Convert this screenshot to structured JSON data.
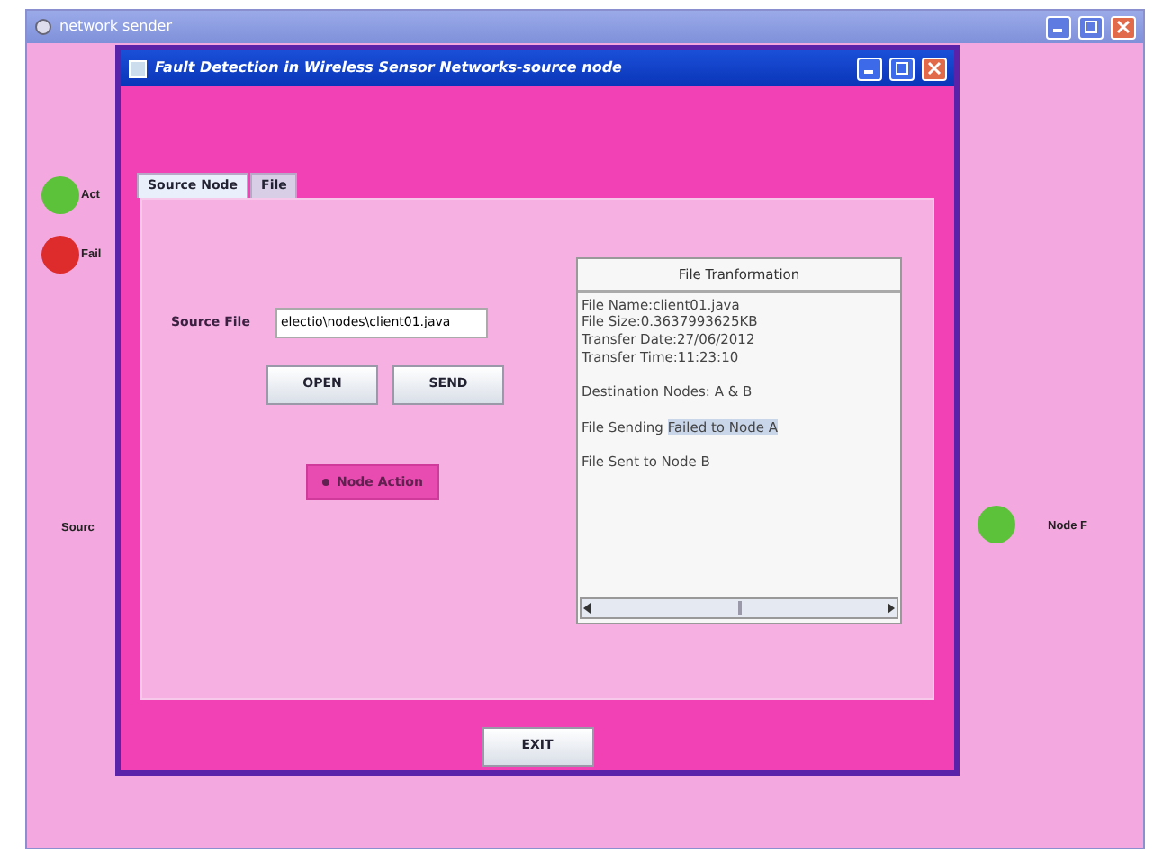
{
  "outer_window": {
    "title": "network sender"
  },
  "legend": [
    {
      "label": "Act",
      "color": "#5cc23a"
    },
    {
      "label": "Fail",
      "color": "#de2b2b"
    }
  ],
  "source_label": "Sourc",
  "node": {
    "label": "Node F",
    "color": "#5cc23a"
  },
  "inner_window": {
    "title": "Fault Detection in Wireless Sensor Networks-source node",
    "tabs": [
      {
        "label": "Source Node",
        "selected": true
      },
      {
        "label": "File",
        "selected": false
      }
    ],
    "source_file": {
      "label": "Source File",
      "value": "electio\\nodes\\client01.java"
    },
    "buttons": [
      "OPEN",
      "SEND"
    ],
    "action_button": "Node Action",
    "log": {
      "header": "File Tranformation",
      "groups": [
        [
          {
            "text": "File Name:client01.java"
          },
          {
            "text": "File Size:0.3637993625KB"
          },
          {
            "text": "Transfer Date:27/06/2012"
          },
          {
            "text": "Transfer Time:11:23:10"
          }
        ],
        [
          {
            "text": "Destination Nodes: A & B"
          }
        ],
        [
          {
            "text": "File Sending ",
            "highlight": "Failed to Node A"
          }
        ],
        [
          {
            "text": "File Sent to Node B"
          }
        ]
      ]
    },
    "exit_button": "EXIT"
  }
}
